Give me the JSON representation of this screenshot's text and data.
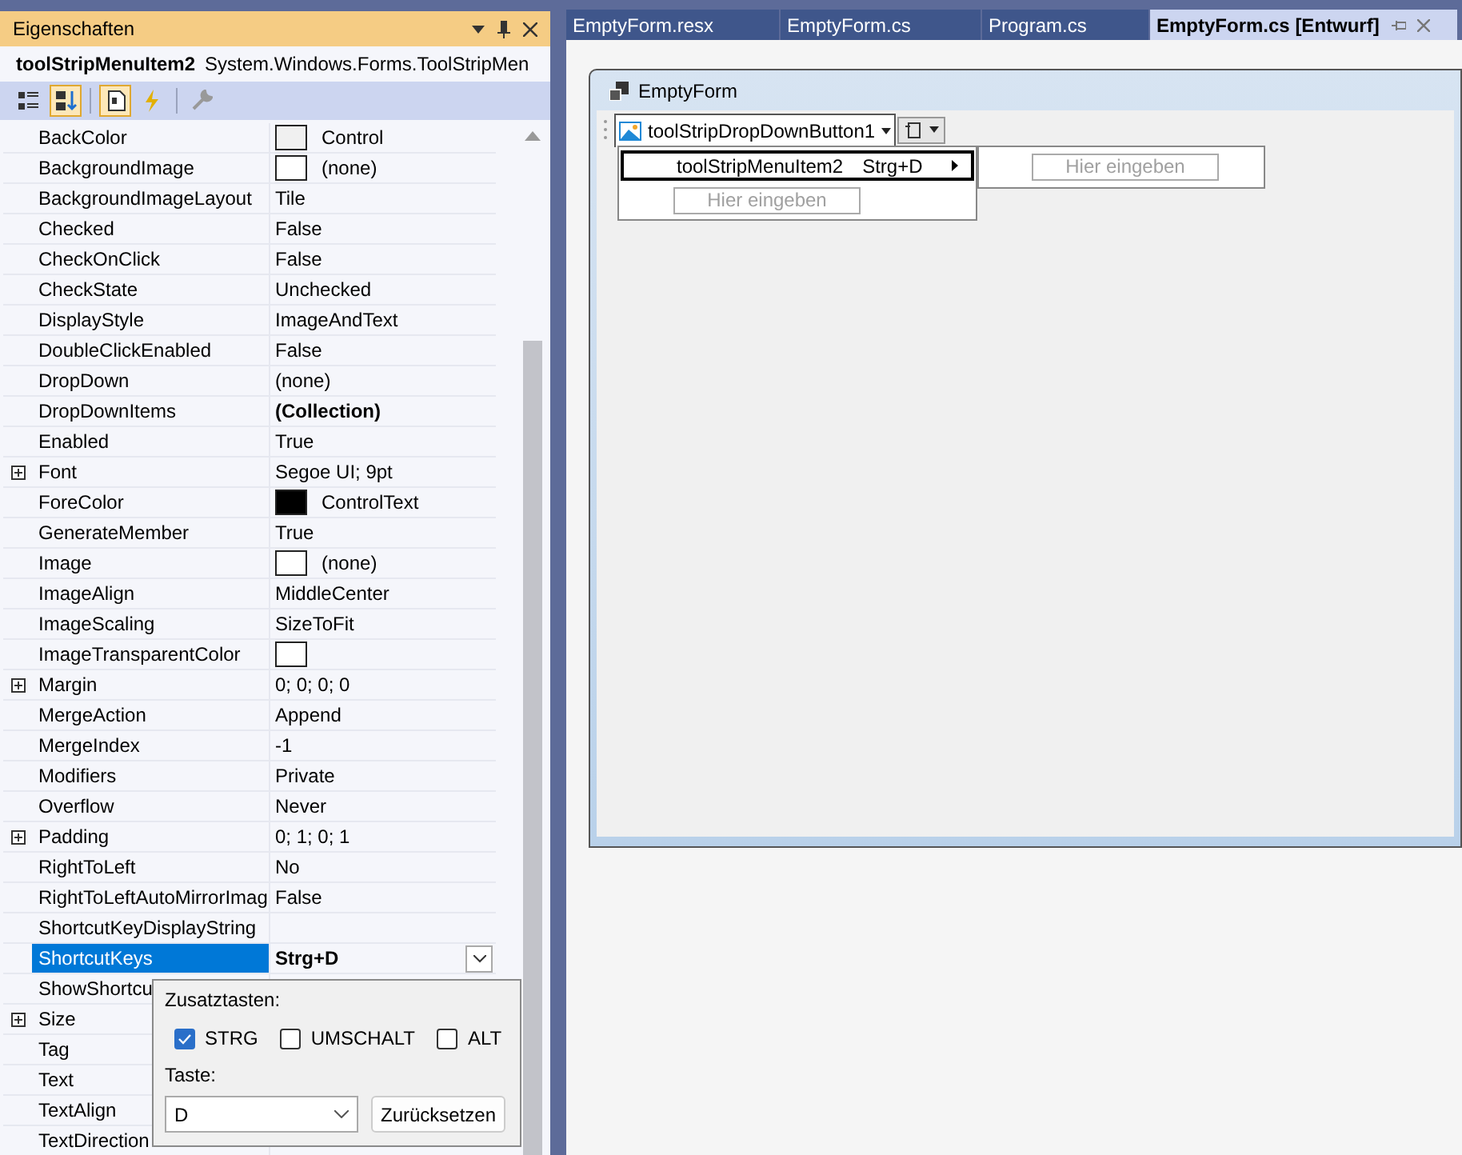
{
  "properties_panel": {
    "title": "Eigenschaften",
    "object_name": "toolStripMenuItem2",
    "object_type": "System.Windows.Forms.ToolStripMen",
    "toolbar": [
      {
        "kind": "categorized",
        "selected": false
      },
      {
        "kind": "alphabetical",
        "selected": true
      },
      {
        "kind": "properties",
        "selected": true
      },
      {
        "kind": "events",
        "selected": false
      },
      {
        "kind": "pages",
        "selected": false
      }
    ],
    "rows": [
      {
        "name": "BackColor",
        "value": "Control",
        "color": "#f0f0f0",
        "expandable": false,
        "selected": false
      },
      {
        "name": "BackgroundImage",
        "value": "(none)",
        "color": "#ffffff",
        "expandable": false,
        "selected": false
      },
      {
        "name": "BackgroundImageLayout",
        "value": "Tile",
        "expandable": false,
        "selected": false
      },
      {
        "name": "Checked",
        "value": "False",
        "expandable": false,
        "selected": false
      },
      {
        "name": "CheckOnClick",
        "value": "False",
        "expandable": false,
        "selected": false
      },
      {
        "name": "CheckState",
        "value": "Unchecked",
        "expandable": false,
        "selected": false
      },
      {
        "name": "DisplayStyle",
        "value": "ImageAndText",
        "expandable": false,
        "selected": false
      },
      {
        "name": "DoubleClickEnabled",
        "value": "False",
        "expandable": false,
        "selected": false
      },
      {
        "name": "DropDown",
        "value": "(none)",
        "expandable": false,
        "selected": false
      },
      {
        "name": "DropDownItems",
        "value": "(Collection)",
        "bold": true,
        "expandable": false,
        "selected": false
      },
      {
        "name": "Enabled",
        "value": "True",
        "expandable": false,
        "selected": false
      },
      {
        "name": "Font",
        "value": "Segoe UI; 9pt",
        "expandable": true,
        "selected": false
      },
      {
        "name": "ForeColor",
        "value": "ControlText",
        "color": "#000000",
        "expandable": false,
        "selected": false
      },
      {
        "name": "GenerateMember",
        "value": "True",
        "expandable": false,
        "selected": false
      },
      {
        "name": "Image",
        "value": "(none)",
        "color": "#ffffff",
        "expandable": false,
        "selected": false
      },
      {
        "name": "ImageAlign",
        "value": "MiddleCenter",
        "expandable": false,
        "selected": false
      },
      {
        "name": "ImageScaling",
        "value": "SizeToFit",
        "expandable": false,
        "selected": false
      },
      {
        "name": "ImageTransparentColor",
        "color": "#ffffff",
        "expandable": false,
        "selected": false
      },
      {
        "name": "Margin",
        "value": "0; 0; 0; 0",
        "expandable": true,
        "selected": false
      },
      {
        "name": "MergeAction",
        "value": "Append",
        "expandable": false,
        "selected": false
      },
      {
        "name": "MergeIndex",
        "value": "-1",
        "expandable": false,
        "selected": false
      },
      {
        "name": "Modifiers",
        "value": "Private",
        "expandable": false,
        "selected": false
      },
      {
        "name": "Overflow",
        "value": "Never",
        "expandable": false,
        "selected": false
      },
      {
        "name": "Padding",
        "value": "0; 1; 0; 1",
        "expandable": true,
        "selected": false
      },
      {
        "name": "RightToLeft",
        "value": "No",
        "expandable": false,
        "selected": false
      },
      {
        "name": "RightToLeftAutoMirrorImag",
        "value": "False",
        "expandable": false,
        "selected": false
      },
      {
        "name": "ShortcutKeyDisplayString",
        "expandable": false,
        "selected": false
      },
      {
        "name": "ShortcutKeys",
        "value": "Strg+D",
        "bold": true,
        "dropdown": true,
        "expandable": false,
        "selected": true
      },
      {
        "name": "ShowShortcu",
        "expandable": false,
        "selected": false
      },
      {
        "name": "Size",
        "expandable": true,
        "selected": false
      },
      {
        "name": "Tag",
        "expandable": false,
        "selected": false
      },
      {
        "name": "Text",
        "expandable": false,
        "selected": false
      },
      {
        "name": "TextAlign",
        "expandable": false,
        "selected": false
      },
      {
        "name": "TextDirection",
        "expandable": false,
        "selected": false
      }
    ],
    "shortcut_popup": {
      "modifiers_label": "Zusatztasten:",
      "modifiers": [
        {
          "label": "STRG",
          "checked": true
        },
        {
          "label": "UMSCHALT",
          "checked": false
        },
        {
          "label": "ALT",
          "checked": false
        }
      ],
      "key_label": "Taste:",
      "key_value": "D",
      "reset_button": "Zurücksetzen"
    }
  },
  "tabs": [
    {
      "label": "EmptyForm.resx",
      "selected": false
    },
    {
      "label": "EmptyForm.cs",
      "selected": false
    },
    {
      "label": "Program.cs",
      "selected": false
    },
    {
      "label": "EmptyForm.cs [Entwurf]",
      "selected": true
    }
  ],
  "designer": {
    "form_title": "EmptyForm",
    "dropdown_button": "toolStripDropDownButton1",
    "menu_items": [
      {
        "label": "toolStripMenuItem2",
        "shortcut": "Strg+D",
        "selected": true
      }
    ],
    "menu_placeholder": "Hier eingeben",
    "submenu_placeholder": "Hier eingeben"
  }
}
